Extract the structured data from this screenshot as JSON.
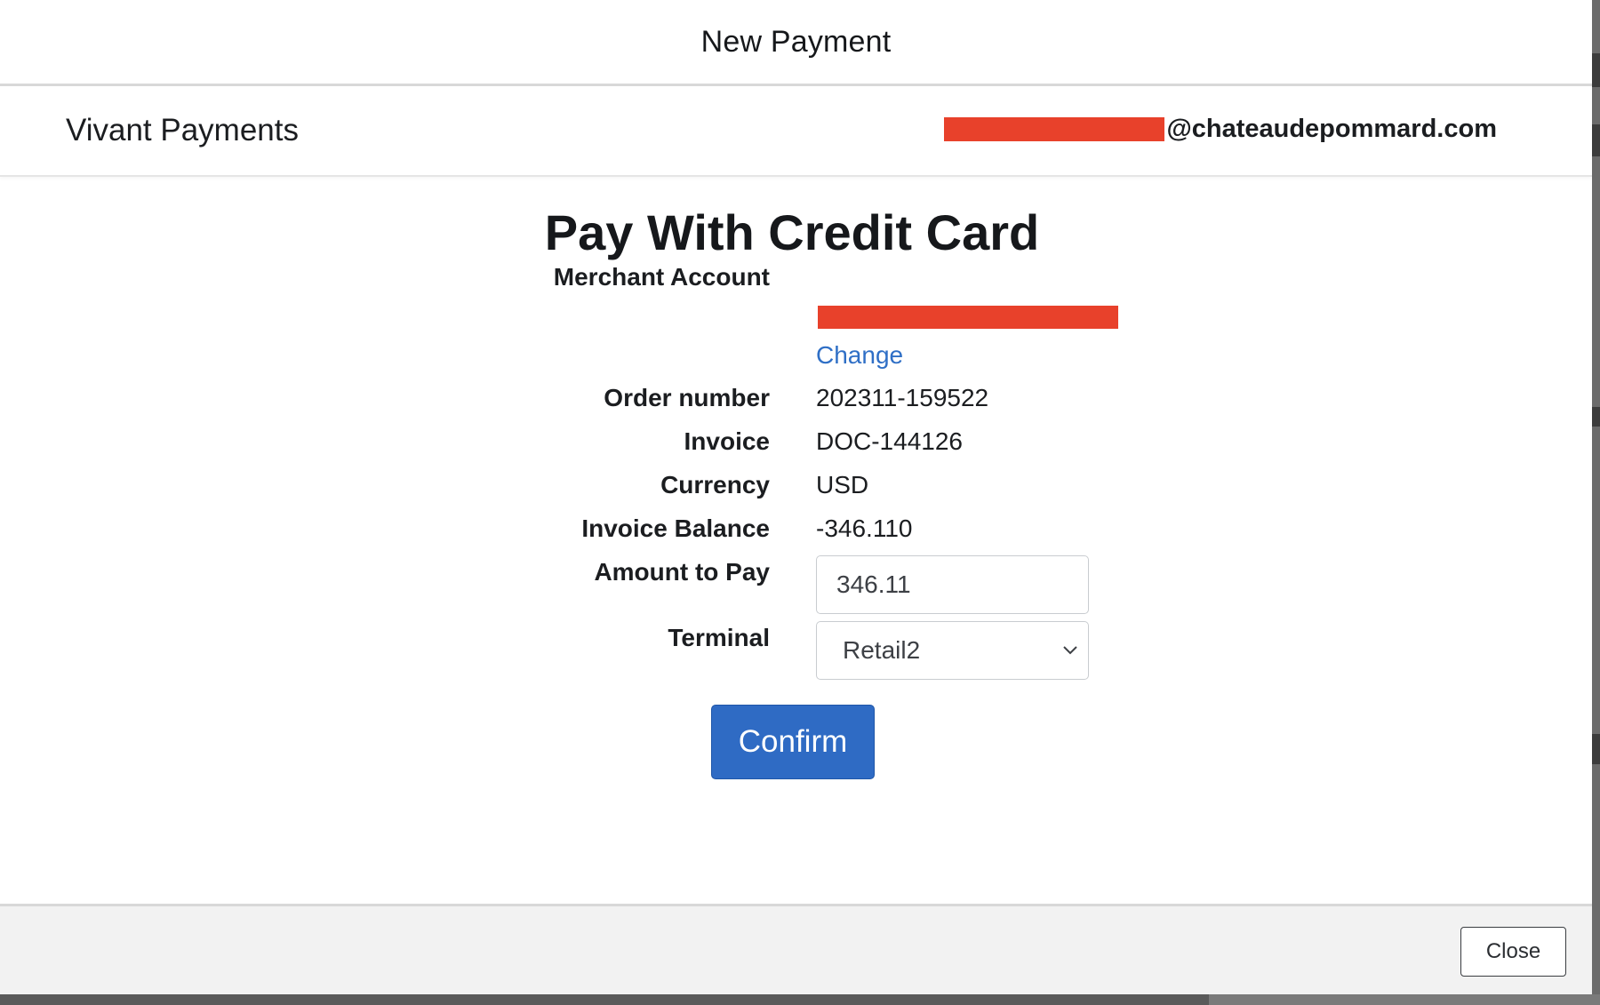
{
  "modal": {
    "title": "New Payment"
  },
  "app_bar": {
    "app_name": "Vivant Payments",
    "user_email_suffix": "@chateaudepommard.com",
    "user_email_redacted": true
  },
  "form": {
    "title": "Pay With Credit Card",
    "merchant_account": {
      "label": "Merchant Account",
      "value_redacted": true,
      "change_link": "Change"
    },
    "order_number": {
      "label": "Order number",
      "value": "202311-159522"
    },
    "invoice": {
      "label": "Invoice",
      "value": "DOC-144126"
    },
    "currency": {
      "label": "Currency",
      "value": "USD"
    },
    "invoice_balance": {
      "label": "Invoice Balance",
      "value": "-346.110"
    },
    "amount_to_pay": {
      "label": "Amount to Pay",
      "value": "346.11"
    },
    "terminal": {
      "label": "Terminal",
      "selected": "Retail2"
    },
    "confirm_label": "Confirm"
  },
  "footer": {
    "close_label": "Close"
  },
  "colors": {
    "redaction": "#e8412b",
    "primary_button": "#2f6bc4",
    "link": "#2f6fc6"
  }
}
